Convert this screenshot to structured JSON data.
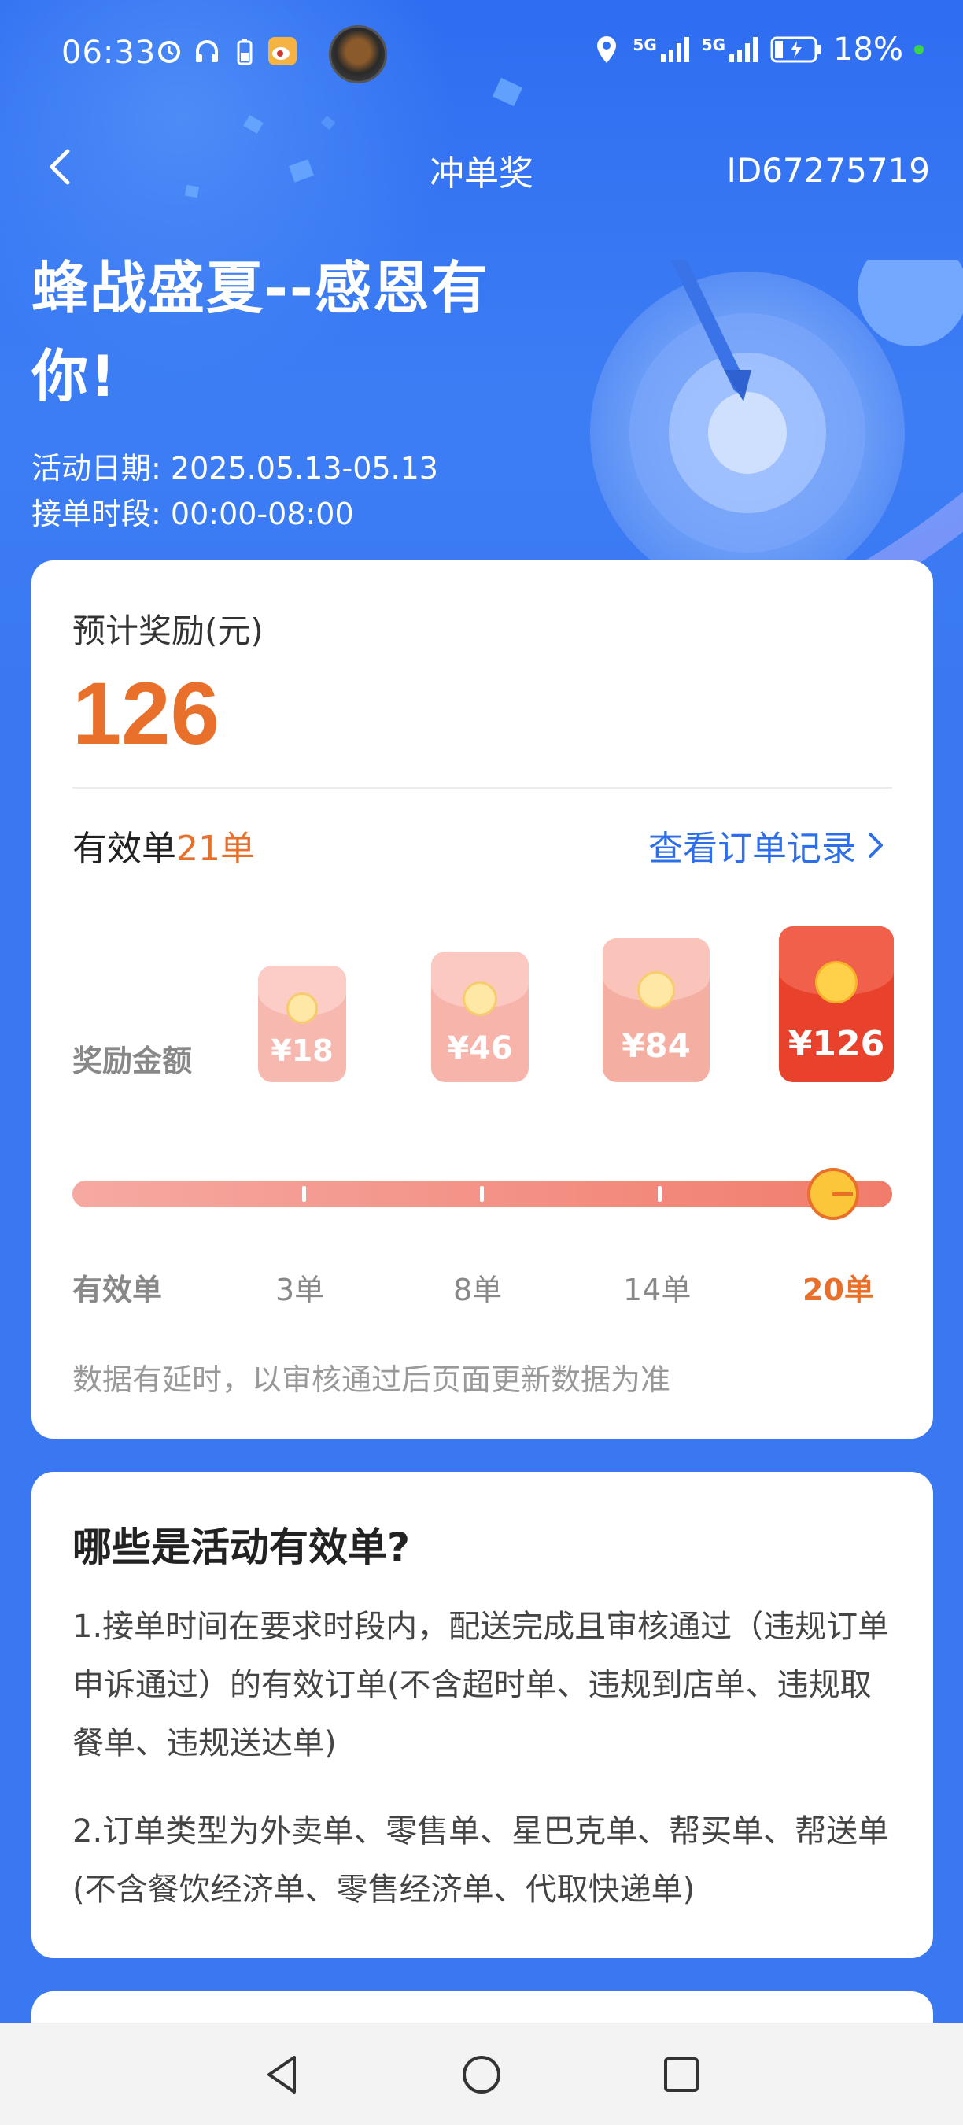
{
  "status_bar": {
    "time": "06:33",
    "left_icons": [
      "alarm-icon",
      "headphones-icon",
      "battery-small-icon",
      "weibo-icon"
    ],
    "signal_1": "5G",
    "signal_2": "5G",
    "battery": "18%"
  },
  "nav": {
    "title": "冲单奖",
    "id_text": "ID67275719"
  },
  "hero": {
    "headline": "蜂战盛夏--感恩有你!",
    "date_label": "活动日期:",
    "date_value": "2025.05.13-05.13",
    "period_label": "接单时段:",
    "period_value": "00:00-08:00"
  },
  "reward_card": {
    "label": "预计奖励(元)",
    "amount": "126",
    "valid_prefix": "有效单",
    "valid_count": "21单",
    "order_link": "查看订单记录",
    "tier_label": "奖励金额",
    "tiers": [
      {
        "amount": "¥18",
        "orders": "3单"
      },
      {
        "amount": "¥46",
        "orders": "8单"
      },
      {
        "amount": "¥84",
        "orders": "14单"
      },
      {
        "amount": "¥126",
        "orders": "20单"
      }
    ],
    "milestone_label": "有效单",
    "progress": 1.0,
    "note": "数据有延时，以审核通过后页面更新数据为准",
    "colors": {
      "accent": "#e8702a",
      "link": "#2e6fe9",
      "envelope_active": "#e8412c"
    }
  },
  "rules_card": {
    "title": "哪些是活动有效单?",
    "rule_1": "1.接单时间在要求时段内，配送完成且审核通过（违规订单申诉通过）的有效订单(不含超时单、违规到店单、违规取餐单、违规送达单)",
    "rule_2": "2.订单类型为外卖单、零售单、星巴克单、帮买单、帮送单(不含餐饮经济单、零售经济单、代取快递单)"
  },
  "system_nav": [
    "back-icon",
    "home-icon",
    "recents-icon"
  ]
}
